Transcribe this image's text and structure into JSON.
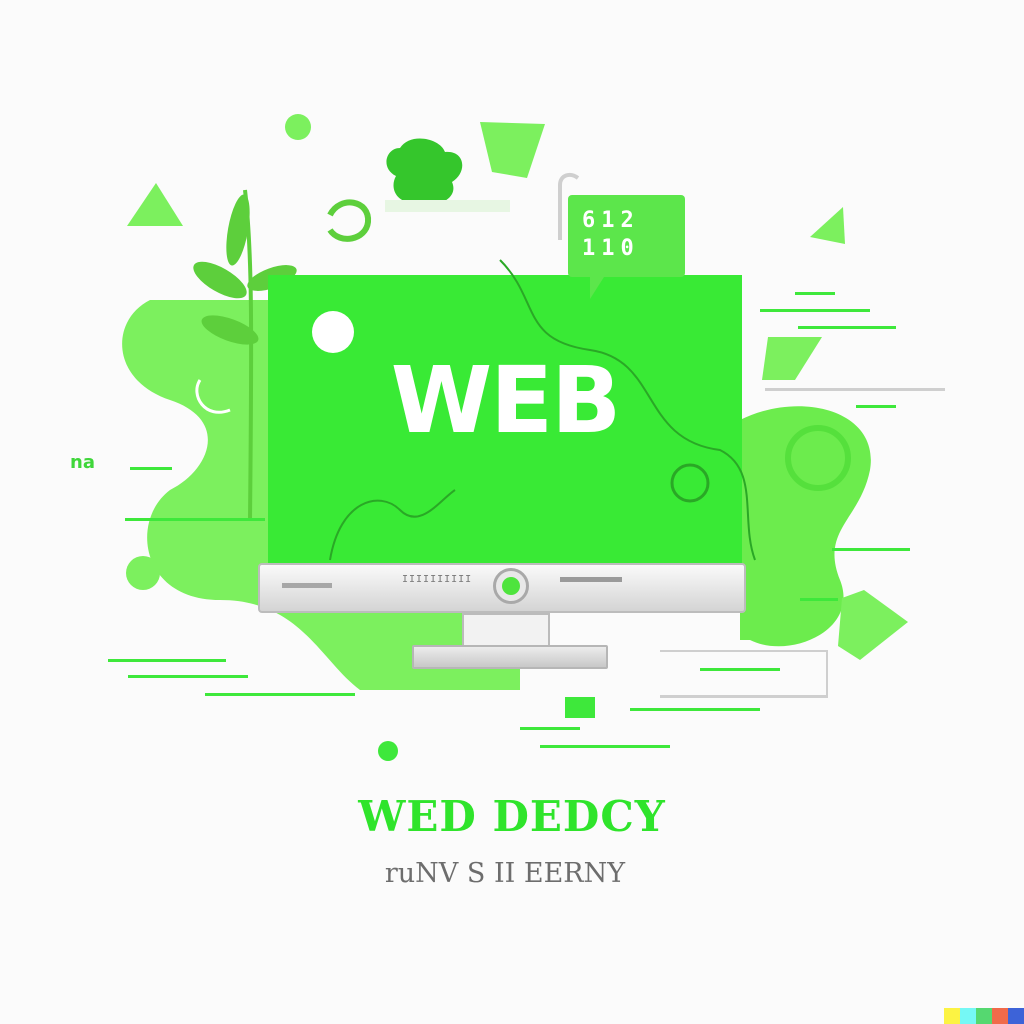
{
  "screen_word": "WEB",
  "chat_bubble": "612\n110",
  "side_glyph": "na",
  "monitor_label": "IIIIIIIIII",
  "headline": "WED DEDCY",
  "subline": "ruNV S  II EERNY",
  "colors": {
    "primary_green": "#3ee83b",
    "screen_green": "#39ea35",
    "blob_green": "#7cf05e",
    "headline_green": "#2fe42b",
    "subline_gray": "#6d6d6d"
  },
  "watermark_colors": [
    "#fcf343",
    "#75f8f5",
    "#55d870",
    "#f06a4a",
    "#3d63d8"
  ]
}
